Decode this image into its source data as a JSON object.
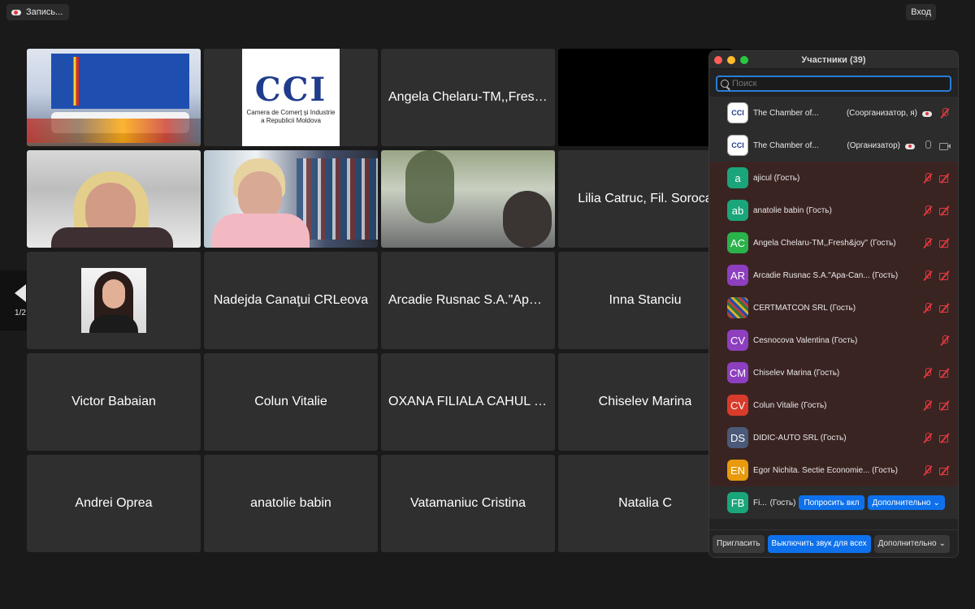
{
  "topbar": {
    "record_label": "Запись...",
    "exit_label": "Вход"
  },
  "pager": {
    "page": "1/2"
  },
  "tiles": {
    "r0c2": "Angela Chelaru-TM,,Fresh&joy''",
    "r1c3": "Lilia  Catruc, Fil. Soroca",
    "r2c1": "Nadejda Canaţui CRLeova",
    "r2c2": "Arcadie Rusnac S.A.\"Apa-Canal\"",
    "r2c3": "Inna Stanciu",
    "r3c0": "Victor Babaian",
    "r3c1": "Colun Vitalie",
    "r3c2": "OXANA FILIALA CAHUL CCI",
    "r3c3": "Chiselev Marina",
    "r4c0": "Andrei Oprea",
    "r4c1": "anatolie babin",
    "r4c2": "Vatamaniuc Cristina",
    "r4c3": "Natalia C"
  },
  "logo": {
    "mark": "CCI",
    "line1": "Camera de Comerţ şi Industrie",
    "line2": "a Republicii Moldova"
  },
  "panel": {
    "title": "Участники (39)",
    "search_placeholder": "Поиск",
    "participants": [
      {
        "initials": "CCI",
        "name": "The Chamber of...",
        "role": "(Соорганизатор, я)"
      },
      {
        "initials": "CCI",
        "name": "The Chamber of...",
        "role": "(Организатор)"
      },
      {
        "initials": "a",
        "name": "ajicul (Гость)",
        "color": "#1aa67a"
      },
      {
        "initials": "ab",
        "name": "anatolie babin (Гость)",
        "color": "#1aa67a"
      },
      {
        "initials": "AC",
        "name": "Angela Chelaru-TM,,Fresh&joy'' (Гость)",
        "color": "#2ab24b"
      },
      {
        "initials": "AR",
        "name": "Arcadie Rusnac S.A.\"Apa-Can... (Гость)",
        "color": "#8d3fbf"
      },
      {
        "initials": "",
        "name": "CERTMATCON SRL (Гость)"
      },
      {
        "initials": "CV",
        "name": "Cesnocova Valentina (Гость)",
        "color": "#8d3fbf"
      },
      {
        "initials": "CM",
        "name": "Chiselev Marina (Гость)",
        "color": "#8d3fbf"
      },
      {
        "initials": "CV",
        "name": "Colun Vitalie (Гость)",
        "color": "#d93b2b"
      },
      {
        "initials": "DS",
        "name": "DIDIC-AUTO SRL (Гость)",
        "color": "#4a5a78"
      },
      {
        "initials": "EN",
        "name": "Egor Nichita. Sectie Economie... (Гость)",
        "color": "#e89a0c"
      },
      {
        "initials": "FB",
        "name": "Fi...",
        "role": "(Гость)",
        "color": "#1aa67a"
      }
    ],
    "row_ask_label": "Попросить вкл",
    "row_more_label": "Дополнительно",
    "footer": {
      "invite": "Пригласить",
      "unmute_all": "Выключить звук для всех",
      "more": "Дополнительно"
    }
  },
  "colors": {
    "accent": "#0e71eb",
    "active_border": "#2ecc40",
    "muted_red": "#e0383e"
  }
}
